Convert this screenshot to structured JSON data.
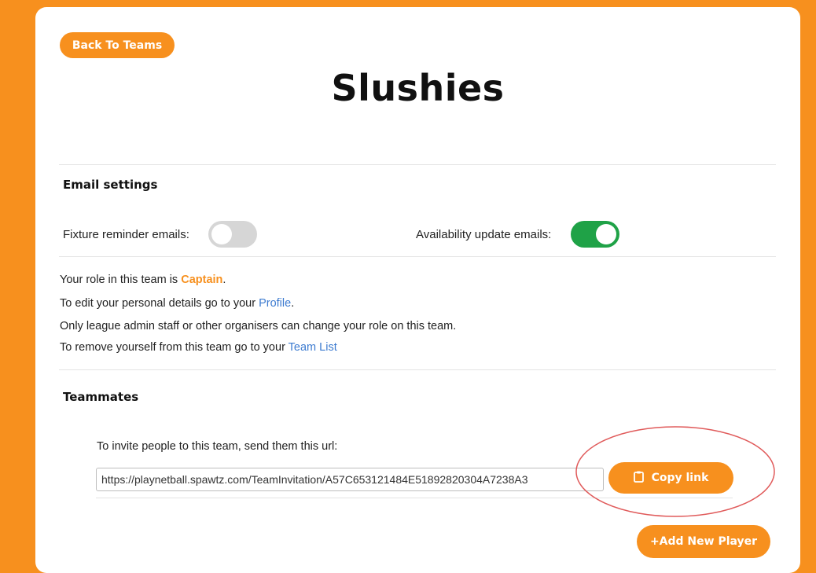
{
  "header": {
    "back_label": "Back To Teams",
    "team_name": "Slushies"
  },
  "email_settings": {
    "heading": "Email settings",
    "fixture_label": "Fixture reminder emails:",
    "fixture_enabled": false,
    "availability_label": "Availability update emails:",
    "availability_enabled": true
  },
  "role_info": {
    "role_prefix": "Your role in this team is ",
    "role_value": "Captain",
    "role_suffix": ".",
    "profile_prefix": "To edit your personal details go to your ",
    "profile_link": "Profile",
    "profile_suffix": ".",
    "admin_note": "Only league admin staff or other organisers can change your role on this team.",
    "remove_prefix": "To remove yourself from this team go to your ",
    "team_list_link": "Team List"
  },
  "teammates": {
    "heading": "Teammates",
    "invite_label": "To invite people to this team, send them this url:",
    "invite_url": "https://playnetball.spawtz.com/TeamInvitation/A57C653121484E51892820304A7238A3",
    "copy_label": "Copy link",
    "add_player_label": "+Add New Player"
  },
  "colors": {
    "accent": "#f7901e",
    "toggle_on": "#1fa247",
    "toggle_off": "#d6d6d6",
    "link": "#3d7bd0",
    "annotation": "#e05a5a"
  },
  "icons": {
    "copy": "clipboard-icon"
  }
}
